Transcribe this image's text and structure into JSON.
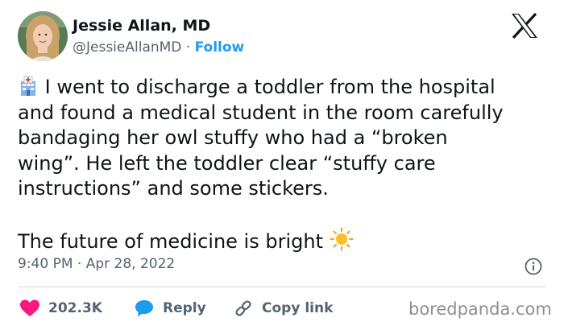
{
  "author": {
    "name": "Jessie Allan, MD",
    "handle": "@JessieAllanMD",
    "separator": "·",
    "follow_label": "Follow",
    "avatar_icon": "profile-photo"
  },
  "tweet": {
    "line1": "I went to discharge a toddler from the hospital",
    "line2": "and found a medical student in the room carefully",
    "line3": "bandaging her owl stuffy who had a “broken",
    "line4": "wing”. He left the toddler clear “stuffy care",
    "line5": "instructions” and some stickers.",
    "line6": "The future of medicine is bright",
    "emoji_start": "hospital-emoji",
    "emoji_end": "sun-emoji"
  },
  "meta": {
    "time": "9:40 PM",
    "separator": "·",
    "date": "Apr 28, 2022"
  },
  "actions": {
    "likes": "202.3K",
    "reply_label": "Reply",
    "copy_label": "Copy link"
  },
  "watermark": "boredpanda.com",
  "colors": {
    "text": "#0f1419",
    "muted": "#536471",
    "link": "#1d9bf0",
    "like": "#f91880",
    "reply": "#1d9bf0",
    "divider": "#cfd9de"
  }
}
